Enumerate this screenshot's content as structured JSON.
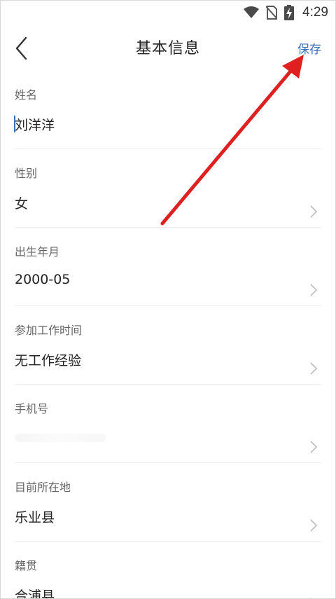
{
  "status_bar": {
    "time": "4:29",
    "icons": [
      "wifi-icon",
      "no-sim-icon",
      "battery-charging-icon"
    ]
  },
  "header": {
    "title": "基本信息",
    "save_label": "保存",
    "back_icon": "chevron-left-icon"
  },
  "fields": [
    {
      "label": "姓名",
      "value": "刘洋洋"
    },
    {
      "label": "性别",
      "value": "女"
    },
    {
      "label": "出生年月",
      "value": "2000-05"
    },
    {
      "label": "参加工作时间",
      "value": "无工作经验"
    },
    {
      "label": "手机号",
      "value": ""
    },
    {
      "label": "目前所在地",
      "value": "乐业县"
    },
    {
      "label": "籍贯",
      "value": "合浦县"
    }
  ],
  "colors": {
    "accent": "#3a6fb8",
    "annotation_arrow": "#e02020"
  }
}
